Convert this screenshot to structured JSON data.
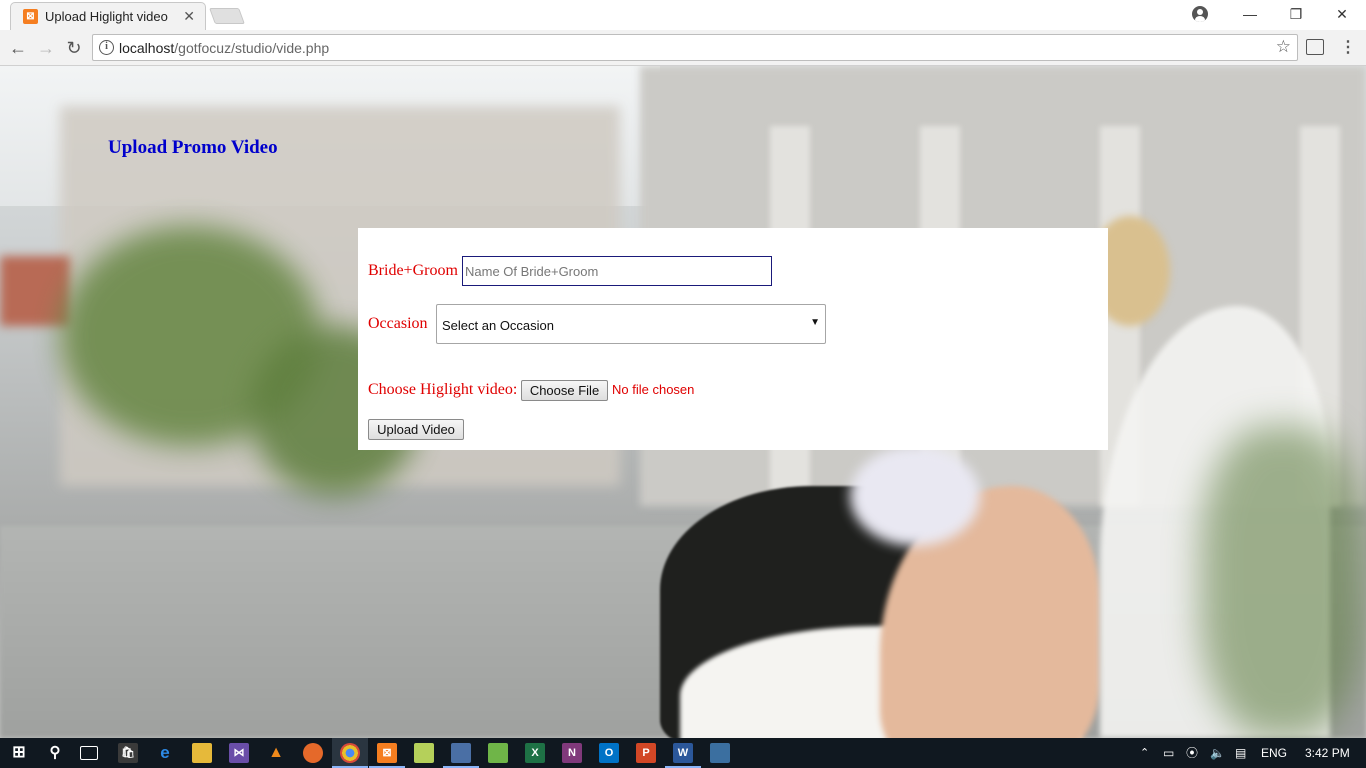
{
  "browser": {
    "tab_title": "Upload Higlight video",
    "tab_favicon": "xampp-icon",
    "url_host": "localhost",
    "url_path": "/gotfocuz/studio/vide.php"
  },
  "page": {
    "heading": "Upload Promo Video",
    "form": {
      "bride_groom_label": "Bride+Groom",
      "bride_groom_placeholder": "Name Of Bride+Groom",
      "bride_groom_value": "",
      "occasion_label": "Occasion",
      "occasion_selected": "Select an Occasion",
      "video_label": "Choose Higlight video:",
      "choose_file_label": "Choose File",
      "file_status": "No file chosen",
      "upload_label": "Upload Video"
    }
  },
  "taskbar": {
    "apps": [
      "start-icon",
      "search-icon",
      "task-view-icon",
      "store-icon",
      "edge-icon",
      "file-explorer-icon",
      "visual-studio-icon",
      "vlc-icon",
      "firefox-icon",
      "chrome-icon",
      "xampp-icon",
      "notepad-icon",
      "sublime-icon",
      "network-icon",
      "excel-icon",
      "onenote-icon",
      "outlook-icon",
      "powerpoint-icon",
      "word-icon",
      "python-icon"
    ],
    "language": "ENG",
    "time": "3:42 PM"
  },
  "colors": {
    "heading": "#0000cc",
    "label": "#e00000",
    "taskbar": "#101820"
  }
}
